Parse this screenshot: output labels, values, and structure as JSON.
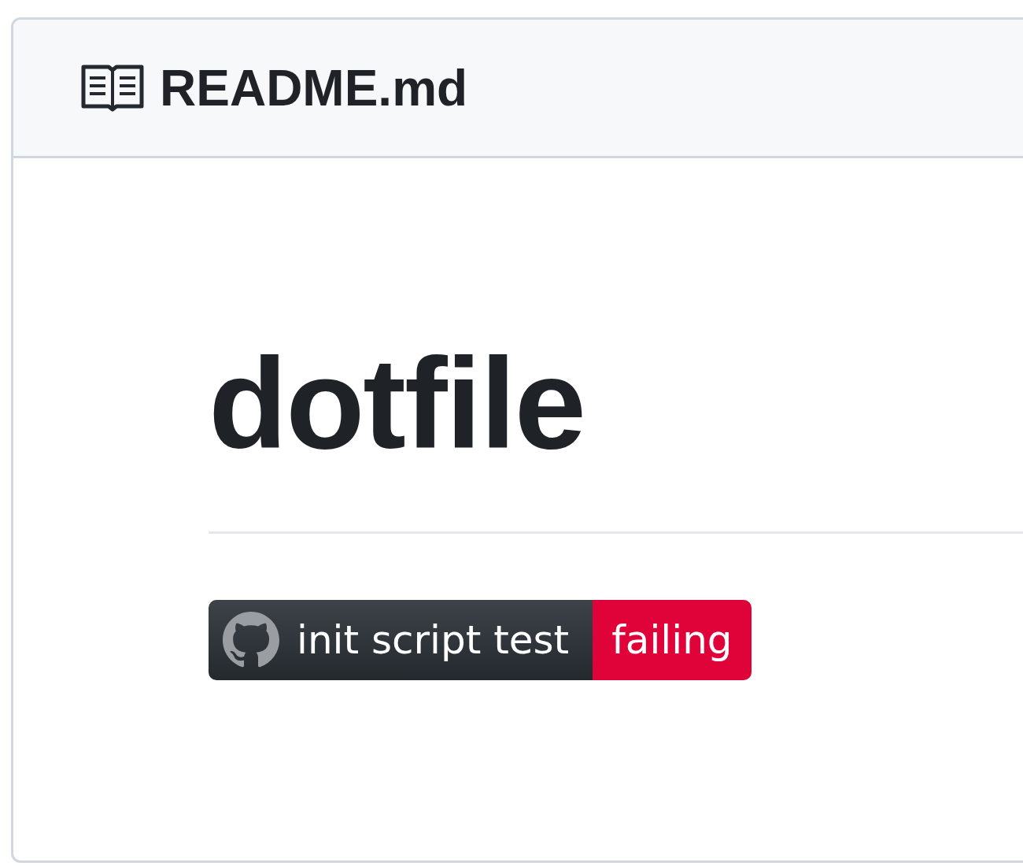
{
  "file": {
    "name": "README.md"
  },
  "heading": "dotfile",
  "badge": {
    "label": "init script test",
    "status": "failing",
    "kind": "failing"
  }
}
